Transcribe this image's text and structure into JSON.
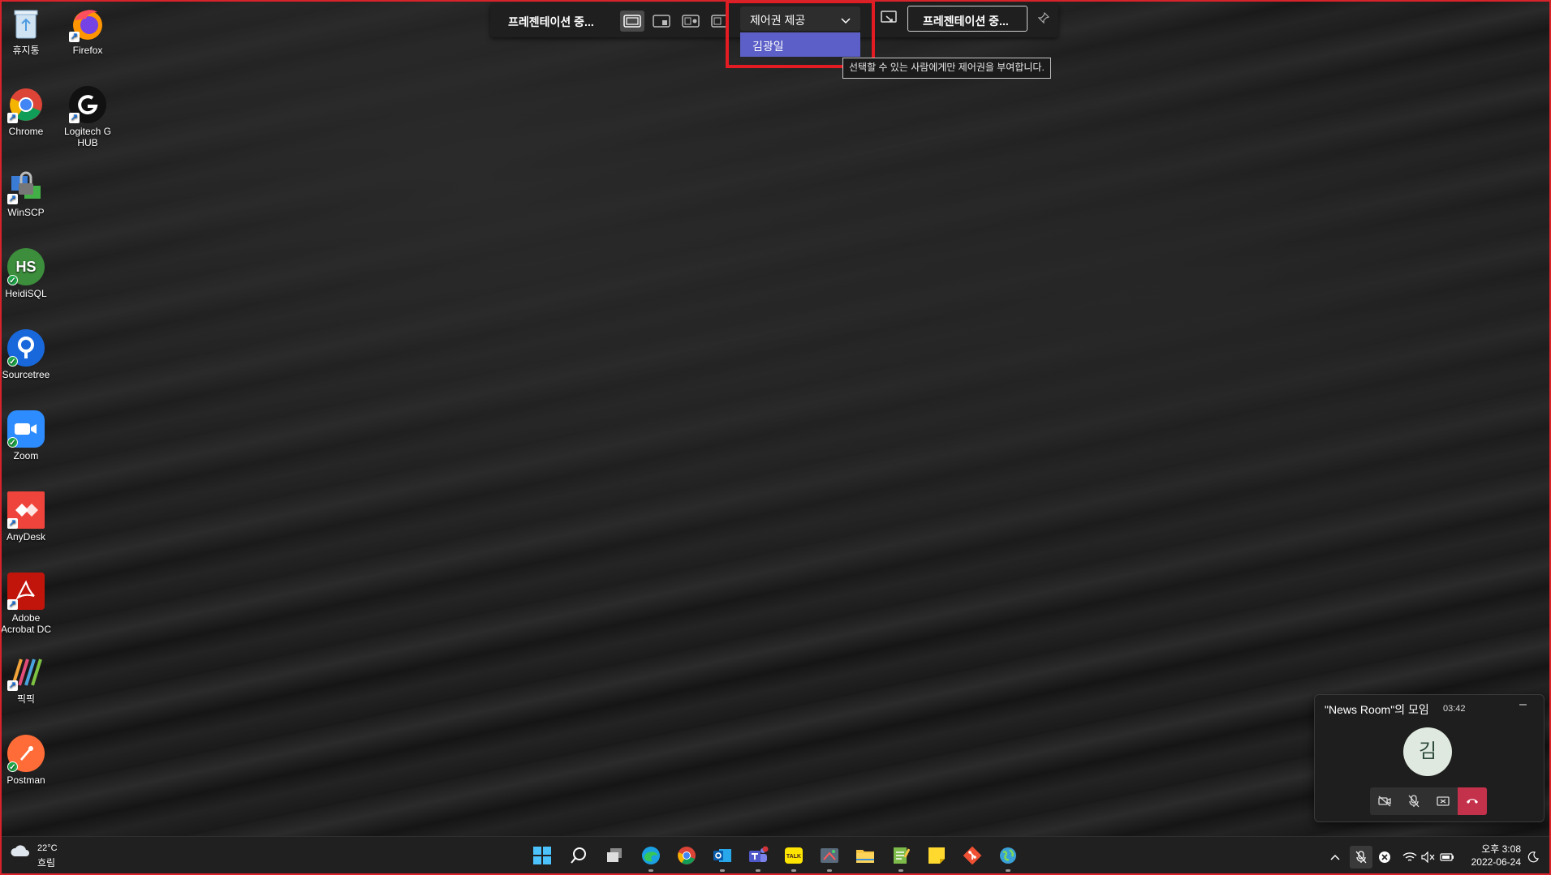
{
  "desktop_icons": [
    {
      "label": "휴지통",
      "icon": "recycle-bin-icon",
      "color": "#6aa8d8"
    },
    {
      "label": "Firefox",
      "icon": "firefox-icon",
      "color": "#ff7139"
    },
    {
      "label": "Chrome",
      "icon": "chrome-icon",
      "color": "#4285f4"
    },
    {
      "label": "Logitech G HUB",
      "icon": "logitech-g-icon",
      "color": "#111111"
    },
    {
      "label": "WinSCP",
      "icon": "winscp-icon",
      "color": "#3a7bd5"
    },
    {
      "label": "HeidiSQL",
      "icon": "heidisql-icon",
      "color": "#3c8d3c",
      "glyph": "HS"
    },
    {
      "label": "Sourcetree",
      "icon": "sourcetree-icon",
      "color": "#1868db"
    },
    {
      "label": "Zoom",
      "icon": "zoom-icon",
      "color": "#2d8cff"
    },
    {
      "label": "AnyDesk",
      "icon": "anydesk-icon",
      "color": "#ef443b"
    },
    {
      "label": "Adobe Acrobat DC",
      "icon": "acrobat-icon",
      "color": "#c1140b"
    },
    {
      "label": "픽픽",
      "icon": "picpick-icon",
      "color": "#444444"
    },
    {
      "label": "Postman",
      "icon": "postman-icon",
      "color": "#ff6c37"
    }
  ],
  "presenter_bar": {
    "title": "프레젠테이션 중...",
    "control_dropdown_label": "제어권 제공",
    "control_option": "김광일",
    "stop_button_label": "프레젠테이션 중...",
    "tooltip": "선택할 수 있는 사람에게만 제어권을 부여합니다."
  },
  "meeting": {
    "title": "\"News Room\"의 모임",
    "duration": "03:42",
    "minimize": "–",
    "avatar_initial": "김"
  },
  "taskbar": {
    "weather_temp": "22°C",
    "weather_condition": "흐림",
    "apps": [
      "start-icon",
      "search-icon",
      "task-view-icon",
      "edge-icon",
      "chrome-icon",
      "outlook-icon",
      "teams-icon",
      "kakaotalk-icon",
      "snipping-tool-icon",
      "file-explorer-icon",
      "notepad-icon",
      "sticky-notes-icon",
      "git-icon",
      "globe-app-icon"
    ],
    "clock_time": "오후 3:08",
    "clock_date": "2022-06-24"
  },
  "colors": {
    "share_border": "#d8232a",
    "highlight_box": "#e31b23",
    "teams_purple": "#5b5fc7",
    "hangup_red": "#c4314b"
  }
}
